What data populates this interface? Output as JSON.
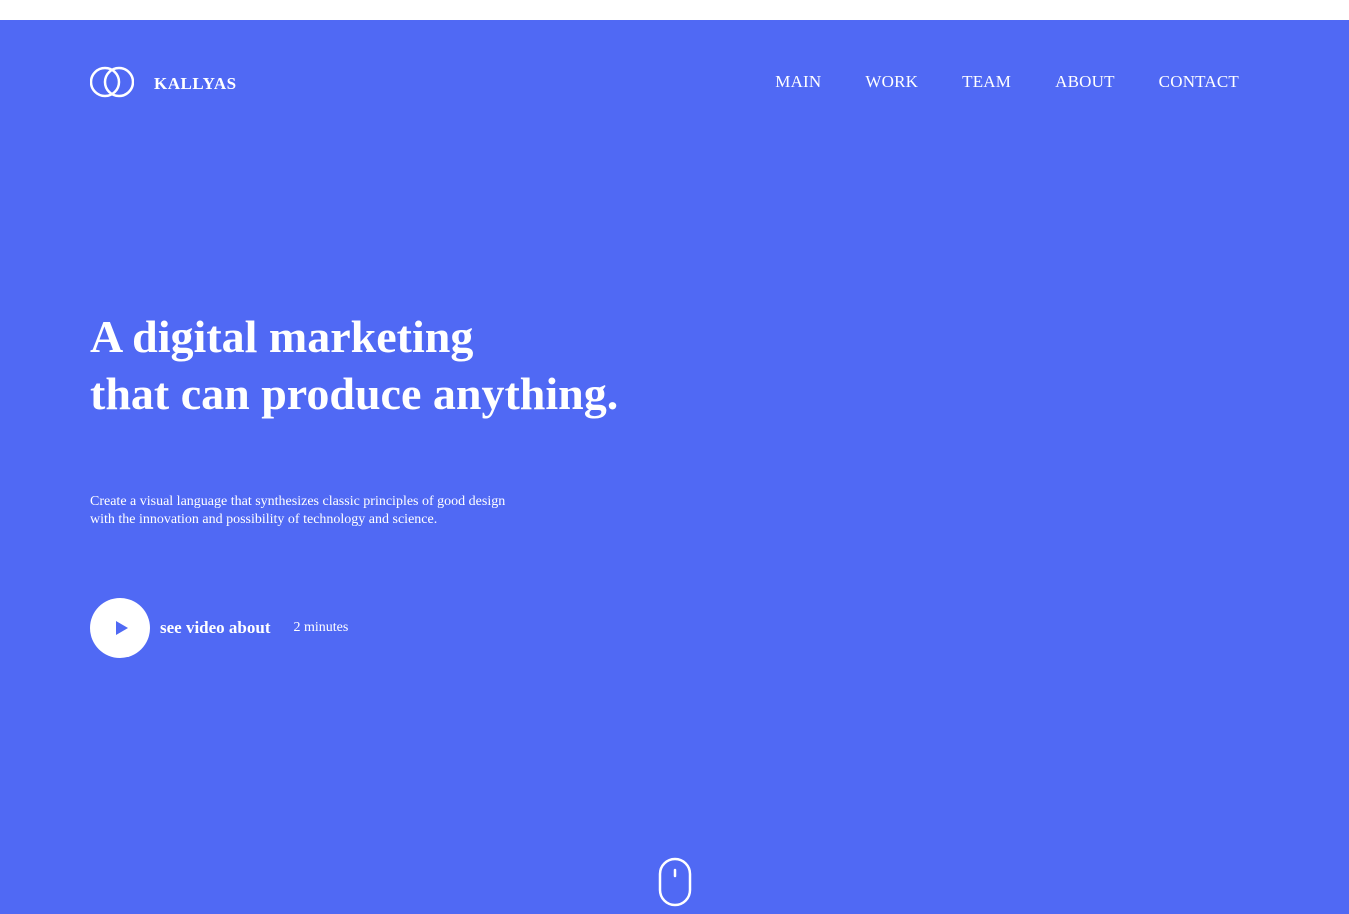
{
  "brand": {
    "name": "KALLYAS",
    "logo_icon": "interlocking-rings-icon"
  },
  "nav": {
    "items": [
      {
        "label": "MAIN"
      },
      {
        "label": "WORK"
      },
      {
        "label": "TEAM"
      },
      {
        "label": "ABOUT"
      },
      {
        "label": "CONTACT"
      }
    ]
  },
  "hero": {
    "headline_line1": "A digital marketing",
    "headline_line2": "that can produce anything.",
    "lede_line1": "Create a visual language that synthesizes classic principles of good design",
    "lede_line2": "with the innovation and possibility of technology and science.",
    "video": {
      "label": "see video about",
      "duration": "2 minutes",
      "icon": "play-icon"
    },
    "scroll_icon": "mouse-scroll-icon"
  },
  "colors": {
    "hero_background": "#5069f4",
    "text": "#ffffff",
    "page_background": "#ffffff"
  }
}
